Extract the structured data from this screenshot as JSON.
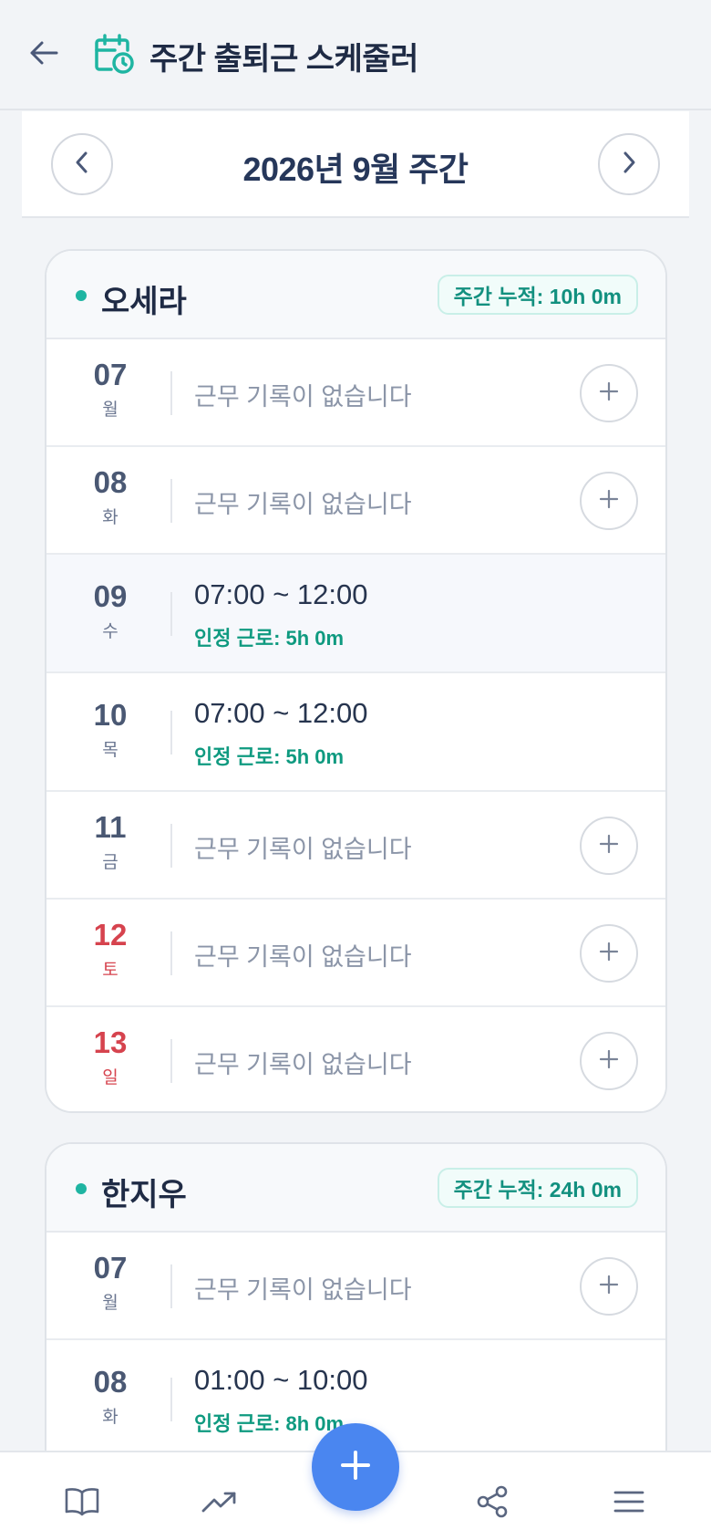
{
  "header": {
    "title": "주간 출퇴근 스케줄러",
    "back_icon": "arrow-left-icon",
    "app_icon": "calendar-clock-icon"
  },
  "week_nav": {
    "label": "2026년 9월 주간",
    "prev_icon": "chevron-left-icon",
    "next_icon": "chevron-right-icon"
  },
  "colors": {
    "accent": "#1fb5a2",
    "approved": "#0f9a80",
    "weekend": "#d6434e",
    "fab": "#4a86f0"
  },
  "people": [
    {
      "name": "오세라",
      "total": "주간 누적: 10h 0m",
      "days": [
        {
          "date": "07",
          "weekday": "월",
          "empty_text": "근무 기록이 없습니다"
        },
        {
          "date": "08",
          "weekday": "화",
          "empty_text": "근무 기록이 없습니다"
        },
        {
          "date": "09",
          "weekday": "수",
          "time": "07:00 ~ 12:00",
          "approved": "인정 근로: 5h 0m"
        },
        {
          "date": "10",
          "weekday": "목",
          "time": "07:00 ~ 12:00",
          "approved": "인정 근로: 5h 0m"
        },
        {
          "date": "11",
          "weekday": "금",
          "empty_text": "근무 기록이 없습니다"
        },
        {
          "date": "12",
          "weekday": "토",
          "empty_text": "근무 기록이 없습니다"
        },
        {
          "date": "13",
          "weekday": "일",
          "empty_text": "근무 기록이 없습니다"
        }
      ]
    },
    {
      "name": "한지우",
      "total": "주간 누적: 24h 0m",
      "days": [
        {
          "date": "07",
          "weekday": "월",
          "empty_text": "근무 기록이 없습니다"
        },
        {
          "date": "08",
          "weekday": "화",
          "time": "01:00 ~ 10:00",
          "approved": "인정 근로: 8h 0m"
        }
      ]
    }
  ],
  "bottom_nav": {
    "items": [
      "book-icon",
      "trending-up-icon",
      "share-icon",
      "menu-icon"
    ],
    "fab_icon": "plus-icon"
  }
}
